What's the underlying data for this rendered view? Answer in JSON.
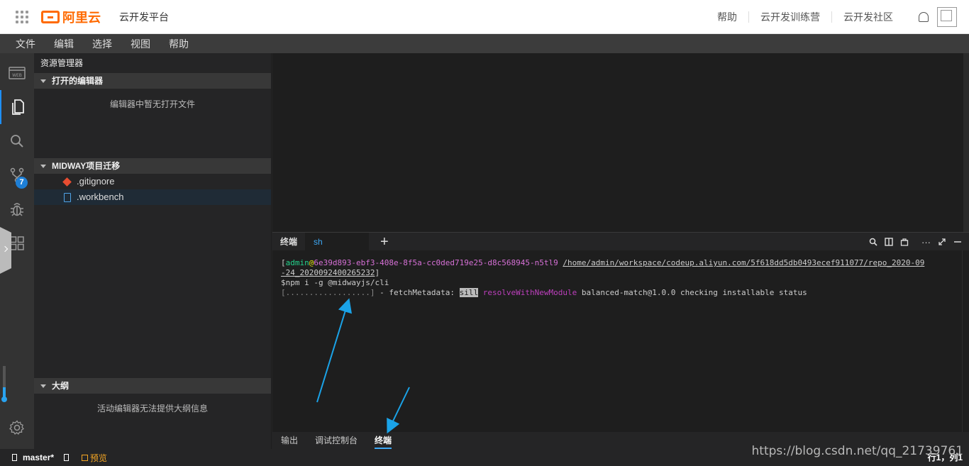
{
  "topbar": {
    "logo_text": "阿里云",
    "platform": "云开发平台",
    "links": [
      "帮助",
      "云开发训练营",
      "云开发社区"
    ]
  },
  "menubar": [
    "文件",
    "编辑",
    "选择",
    "视图",
    "帮助"
  ],
  "activitybar": {
    "scm_badge": "7"
  },
  "sidebar": {
    "title": "资源管理器",
    "open_editors": "打开的编辑器",
    "open_editors_empty": "编辑器中暂无打开文件",
    "project": "MIDWAY项目迁移",
    "files": [
      ".gitignore",
      ".workbench"
    ],
    "outline": "大纲",
    "outline_empty": "活动编辑器无法提供大纲信息"
  },
  "panel": {
    "tabs": [
      "终端",
      "sh"
    ],
    "bottom_tabs": [
      "输出",
      "调试控制台",
      "终端"
    ],
    "terminal": {
      "bracket_open": "[",
      "user": "admin",
      "at": "@",
      "host": "6e39d893-ebf3-408e-8f5a-cc0ded719e25-d8c568945-n5tl9",
      "path_line1": "/home/admin/workspace/codeup.aliyun.com/5f618dd5db0493ecef911077/repo_2020-09",
      "path_line2": "-24_2020092400265232",
      "bracket_close": "]",
      "cmd": "$npm i -g @midwayjs/cli",
      "progress_dots": "[..................]",
      "progress_text": " - fetchMetadata: ",
      "sill": "sill",
      "resolve": "resolveWithNewModule",
      "status": " balanced-match@1.0.0 checking installable status"
    }
  },
  "statusbar": {
    "branch": "master*",
    "preview": "预览",
    "cursor": "行1，列1",
    "watermark": "https://blog.csdn.net/qq_21739761"
  }
}
